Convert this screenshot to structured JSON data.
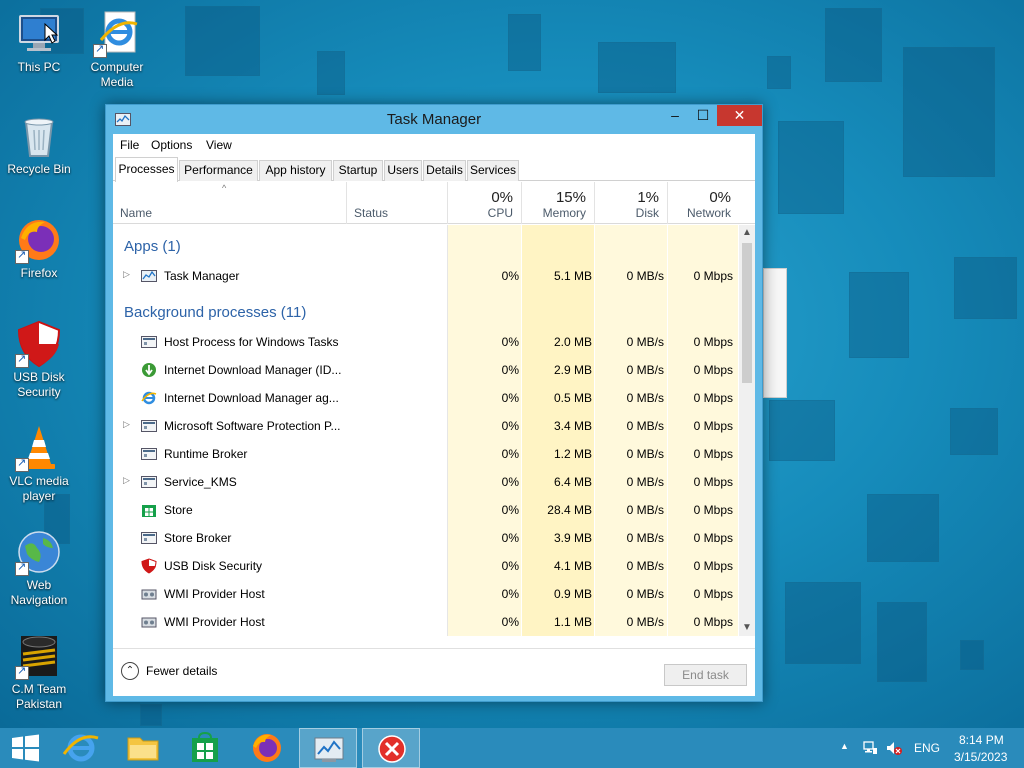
{
  "desktop": {
    "icons": [
      {
        "label": "This PC"
      },
      {
        "label": "Computer Media"
      },
      {
        "label": "Recycle Bin"
      },
      {
        "label": "Firefox"
      },
      {
        "label": "USB Disk Security"
      },
      {
        "label": "VLC media player"
      },
      {
        "label": "Web Navigation"
      },
      {
        "label": "C.M Team Pakistan"
      }
    ]
  },
  "window": {
    "title": "Task Manager",
    "menu": [
      "File",
      "Options",
      "View"
    ],
    "tabs": [
      "Processes",
      "Performance",
      "App history",
      "Startup",
      "Users",
      "Details",
      "Services"
    ],
    "active_tab": "Processes",
    "columns": {
      "name": "Name",
      "status": "Status",
      "cpu": {
        "pct": "0%",
        "label": "CPU"
      },
      "memory": {
        "pct": "15%",
        "label": "Memory"
      },
      "disk": {
        "pct": "1%",
        "label": "Disk"
      },
      "network": {
        "pct": "0%",
        "label": "Network"
      }
    },
    "groups": {
      "apps": "Apps (1)",
      "background": "Background processes (11)"
    },
    "apps": [
      {
        "name": "Task Manager",
        "cpu": "0%",
        "memory": "5.1 MB",
        "disk": "0 MB/s",
        "network": "0 Mbps",
        "icon": "task-manager-icon",
        "expandable": true
      }
    ],
    "background": [
      {
        "name": "Host Process for Windows Tasks",
        "cpu": "0%",
        "memory": "2.0 MB",
        "disk": "0 MB/s",
        "network": "0 Mbps",
        "icon": "process-icon",
        "expandable": false
      },
      {
        "name": "Internet Download Manager (ID...",
        "cpu": "0%",
        "memory": "2.9 MB",
        "disk": "0 MB/s",
        "network": "0 Mbps",
        "icon": "idm-icon",
        "expandable": false
      },
      {
        "name": "Internet Download Manager ag...",
        "cpu": "0%",
        "memory": "0.5 MB",
        "disk": "0 MB/s",
        "network": "0 Mbps",
        "icon": "ie-icon",
        "expandable": false
      },
      {
        "name": "Microsoft Software Protection P...",
        "cpu": "0%",
        "memory": "3.4 MB",
        "disk": "0 MB/s",
        "network": "0 Mbps",
        "icon": "process-icon",
        "expandable": true
      },
      {
        "name": "Runtime Broker",
        "cpu": "0%",
        "memory": "1.2 MB",
        "disk": "0 MB/s",
        "network": "0 Mbps",
        "icon": "process-icon",
        "expandable": false
      },
      {
        "name": "Service_KMS",
        "cpu": "0%",
        "memory": "6.4 MB",
        "disk": "0 MB/s",
        "network": "0 Mbps",
        "icon": "process-icon",
        "expandable": true
      },
      {
        "name": "Store",
        "cpu": "0%",
        "memory": "28.4 MB",
        "disk": "0 MB/s",
        "network": "0 Mbps",
        "icon": "store-icon",
        "expandable": false
      },
      {
        "name": "Store Broker",
        "cpu": "0%",
        "memory": "3.9 MB",
        "disk": "0 MB/s",
        "network": "0 Mbps",
        "icon": "process-icon",
        "expandable": false
      },
      {
        "name": "USB Disk Security",
        "cpu": "0%",
        "memory": "4.1 MB",
        "disk": "0 MB/s",
        "network": "0 Mbps",
        "icon": "shield-icon",
        "expandable": false
      },
      {
        "name": "WMI Provider Host",
        "cpu": "0%",
        "memory": "0.9 MB",
        "disk": "0 MB/s",
        "network": "0 Mbps",
        "icon": "wmi-icon",
        "expandable": false
      },
      {
        "name": "WMI Provider Host",
        "cpu": "0%",
        "memory": "1.1 MB",
        "disk": "0 MB/s",
        "network": "0 Mbps",
        "icon": "wmi-icon",
        "expandable": false
      }
    ],
    "footer": {
      "fewer_details": "Fewer details",
      "end_task": "End task"
    }
  },
  "taskbar": {
    "tray": {
      "language": "ENG",
      "time": "8:14 PM",
      "date": "3/15/2023"
    }
  },
  "colors": {
    "accent": "#2d63a8",
    "band_light": "#fff9dc",
    "band_mid": "#fff4c4",
    "close_red": "#c7372f"
  }
}
